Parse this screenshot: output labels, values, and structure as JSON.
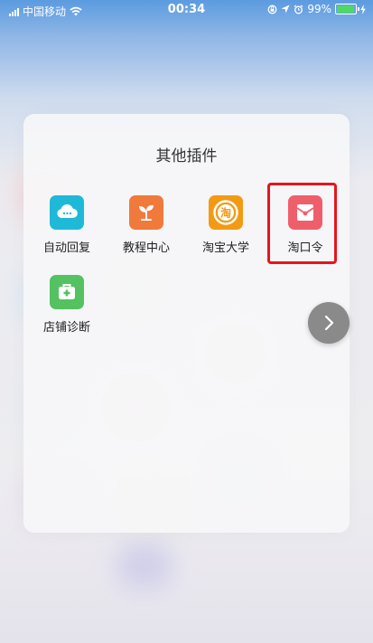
{
  "status_bar": {
    "carrier": "中国移动",
    "time": "00:34",
    "battery_percent": "99%",
    "battery_level": 0.99
  },
  "panel": {
    "title": "其他插件",
    "plugins": [
      {
        "label": "自动回复",
        "icon": "cloud-chat-icon",
        "color": "#1fb9d8"
      },
      {
        "label": "教程中心",
        "icon": "sprout-icon",
        "color": "#f07a3c"
      },
      {
        "label": "淘宝大学",
        "icon": "taobao-university-icon",
        "color": "#f39a14",
        "glyph": "淘"
      },
      {
        "label": "淘口令",
        "icon": "red-envelope-icon",
        "color": "#ef5f6b"
      },
      {
        "label": "店铺诊断",
        "icon": "medical-kit-icon",
        "color": "#54c260"
      }
    ],
    "highlighted_plugin": "淘口令"
  },
  "next_button": {
    "icon": "chevron-right-icon"
  },
  "colors": {
    "highlight": "#e8141d"
  }
}
